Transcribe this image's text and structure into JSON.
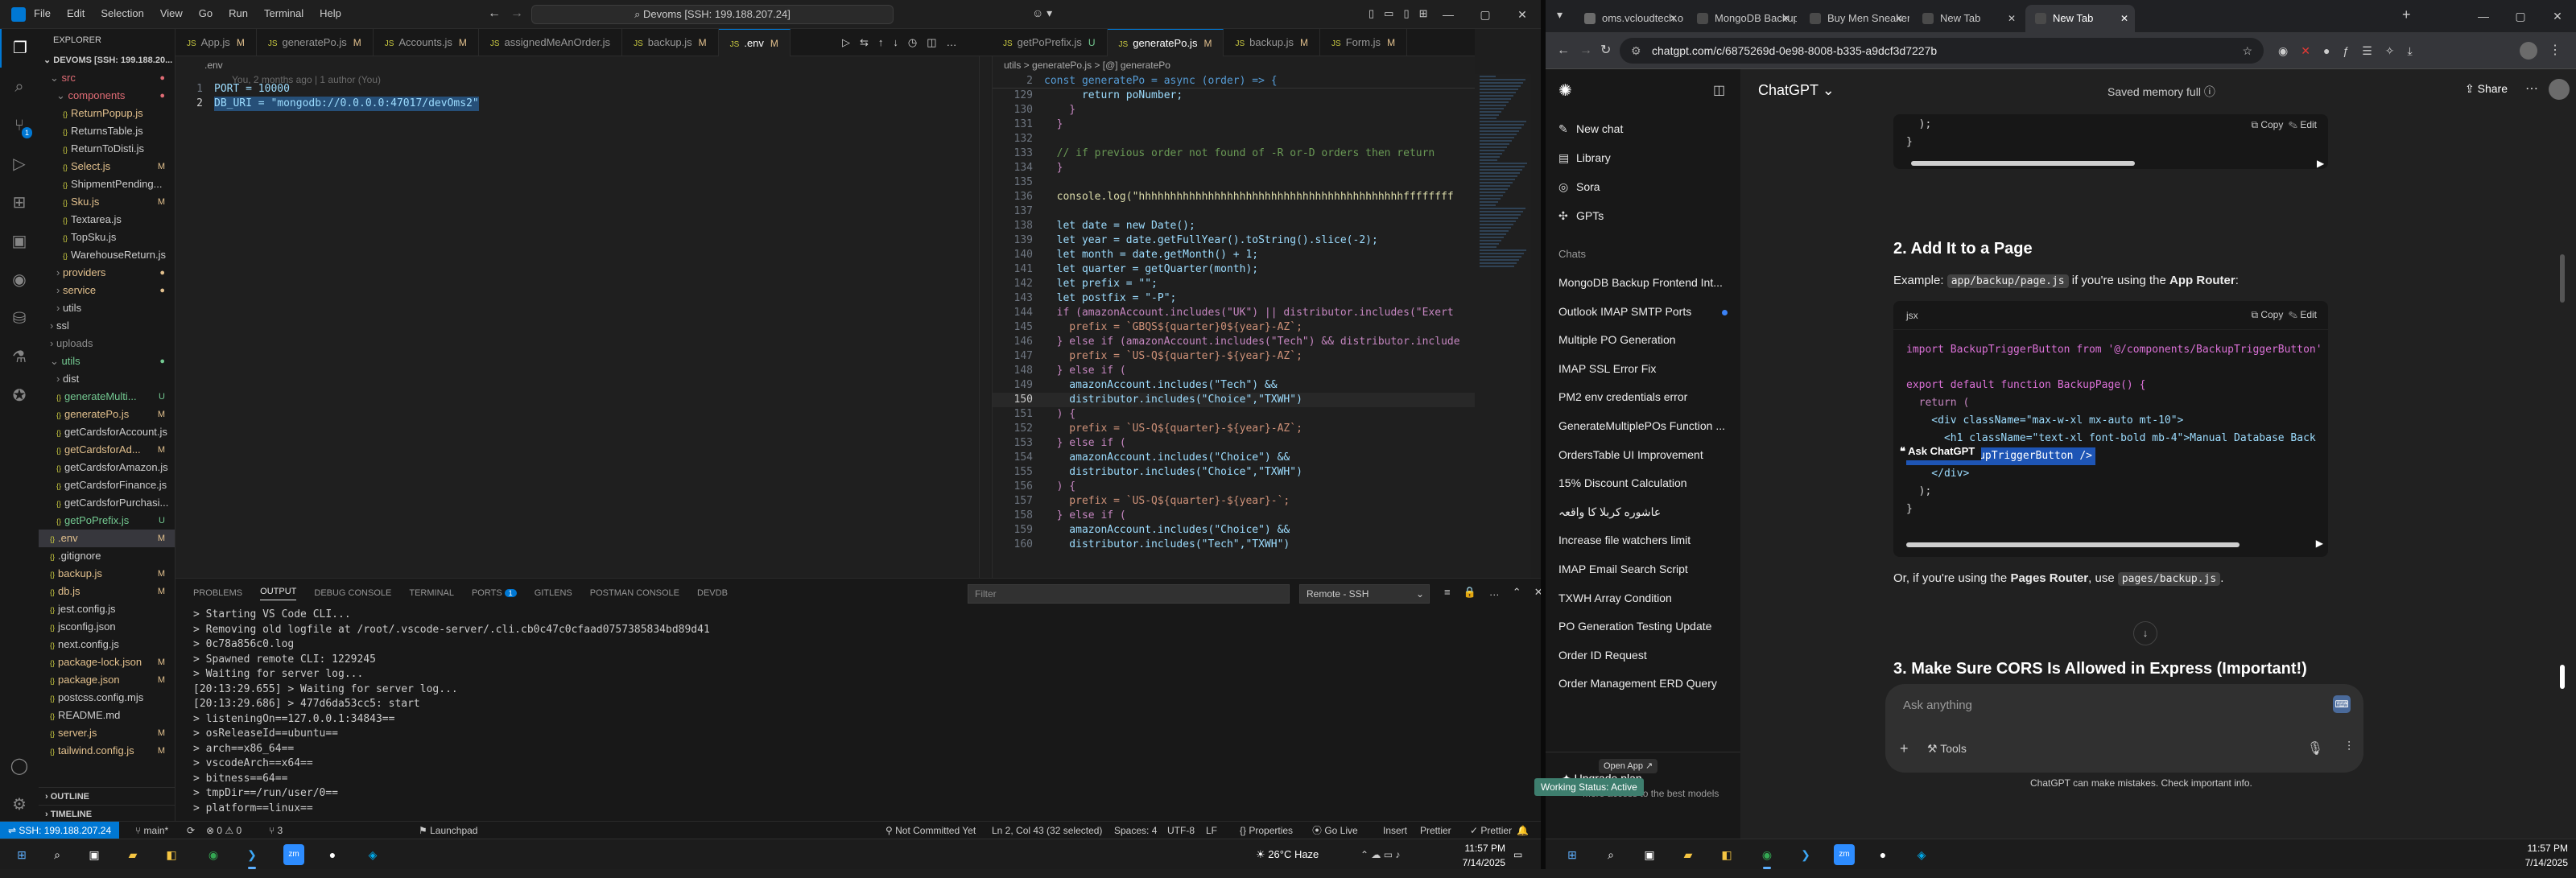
{
  "vscode": {
    "menu": [
      "File",
      "Edit",
      "Selection",
      "View",
      "Go",
      "Run",
      "Terminal",
      "Help"
    ],
    "search": "Devoms [SSH: 199.188.207.24]",
    "explorer_title": "EXPLORER",
    "root": "DEVOMS [SSH: 199.188.20...",
    "tree": [
      {
        "label": "src",
        "indent": 1,
        "type": "folder",
        "open": true,
        "color": "r",
        "status": "●"
      },
      {
        "label": "components",
        "indent": 2,
        "type": "folder",
        "open": true,
        "color": "r",
        "status": "●"
      },
      {
        "label": "ReturnPopup.js",
        "indent": 3,
        "type": "file",
        "color": "y",
        "status": ""
      },
      {
        "label": "ReturnsTable.js",
        "indent": 3,
        "type": "file",
        "color": "w",
        "status": ""
      },
      {
        "label": "ReturnToDisti.js",
        "indent": 3,
        "type": "file",
        "color": "w",
        "status": ""
      },
      {
        "label": "Select.js",
        "indent": 3,
        "type": "file",
        "color": "y",
        "status": "M"
      },
      {
        "label": "ShipmentPending...",
        "indent": 3,
        "type": "file",
        "color": "w",
        "status": ""
      },
      {
        "label": "Sku.js",
        "indent": 3,
        "type": "file",
        "color": "y",
        "status": "M"
      },
      {
        "label": "Textarea.js",
        "indent": 3,
        "type": "file",
        "color": "w",
        "status": ""
      },
      {
        "label": "TopSku.js",
        "indent": 3,
        "type": "file",
        "color": "w",
        "status": ""
      },
      {
        "label": "WarehouseReturn.js",
        "indent": 3,
        "type": "file",
        "color": "w",
        "status": ""
      },
      {
        "label": "providers",
        "indent": 2,
        "type": "folder",
        "open": false,
        "color": "y",
        "status": "●"
      },
      {
        "label": "service",
        "indent": 2,
        "type": "folder",
        "open": false,
        "color": "y",
        "status": "●"
      },
      {
        "label": "utils",
        "indent": 2,
        "type": "folder",
        "open": false,
        "color": "w",
        "status": ""
      },
      {
        "label": "ssl",
        "indent": 1,
        "type": "folder",
        "open": false,
        "color": "w",
        "status": ""
      },
      {
        "label": "uploads",
        "indent": 1,
        "type": "folder",
        "open": false,
        "color": "d",
        "status": ""
      },
      {
        "label": "utils",
        "indent": 1,
        "type": "folder",
        "open": true,
        "color": "g",
        "status": "●"
      },
      {
        "label": "dist",
        "indent": 2,
        "type": "folder",
        "open": false,
        "color": "w",
        "status": ""
      },
      {
        "label": "generateMulti...",
        "indent": 2,
        "type": "file",
        "color": "g",
        "status": "U"
      },
      {
        "label": "generatePo.js",
        "indent": 2,
        "type": "file",
        "color": "y",
        "status": "M"
      },
      {
        "label": "getCardsforAccount.js",
        "indent": 2,
        "type": "file",
        "color": "w",
        "status": ""
      },
      {
        "label": "getCardsforAd...",
        "indent": 2,
        "type": "file",
        "color": "y",
        "status": "M"
      },
      {
        "label": "getCardsforAmazon.js",
        "indent": 2,
        "type": "file",
        "color": "w",
        "status": ""
      },
      {
        "label": "getCardsforFinance.js",
        "indent": 2,
        "type": "file",
        "color": "w",
        "status": ""
      },
      {
        "label": "getCardsforPurchasi...",
        "indent": 2,
        "type": "file",
        "color": "w",
        "status": ""
      },
      {
        "label": "getPoPrefix.js",
        "indent": 2,
        "type": "file",
        "color": "g",
        "status": "U"
      },
      {
        "label": ".env",
        "indent": 1,
        "type": "file",
        "color": "y",
        "status": "M",
        "selected": true
      },
      {
        "label": ".gitignore",
        "indent": 1,
        "type": "file",
        "color": "w",
        "status": ""
      },
      {
        "label": "backup.js",
        "indent": 1,
        "type": "file",
        "color": "y",
        "status": "M"
      },
      {
        "label": "db.js",
        "indent": 1,
        "type": "file",
        "color": "y",
        "status": "M"
      },
      {
        "label": "jest.config.js",
        "indent": 1,
        "type": "file",
        "color": "w",
        "status": ""
      },
      {
        "label": "jsconfig.json",
        "indent": 1,
        "type": "file",
        "color": "w",
        "status": ""
      },
      {
        "label": "next.config.js",
        "indent": 1,
        "type": "file",
        "color": "w",
        "status": ""
      },
      {
        "label": "package-lock.json",
        "indent": 1,
        "type": "file",
        "color": "y",
        "status": "M"
      },
      {
        "label": "package.json",
        "indent": 1,
        "type": "file",
        "color": "y",
        "status": "M"
      },
      {
        "label": "postcss.config.mjs",
        "indent": 1,
        "type": "file",
        "color": "w",
        "status": ""
      },
      {
        "label": "README.md",
        "indent": 1,
        "type": "file",
        "color": "w",
        "status": ""
      },
      {
        "label": "server.js",
        "indent": 1,
        "type": "file",
        "color": "y",
        "status": "M"
      },
      {
        "label": "tailwind.config.js",
        "indent": 1,
        "type": "file",
        "color": "y",
        "status": "M"
      }
    ],
    "outline": "OUTLINE",
    "timeline": "TIMELINE",
    "tabs": [
      {
        "label": "App.js",
        "status": "M",
        "active": false
      },
      {
        "label": "generatePo.js",
        "status": "M",
        "active": false
      },
      {
        "label": "Accounts.js",
        "status": "M",
        "active": false
      },
      {
        "label": "assignedMeAnOrder.js",
        "status": "",
        "active": false
      },
      {
        "label": "backup.js",
        "status": "M",
        "active": false
      },
      {
        "label": ".env",
        "status": "M",
        "active": true
      }
    ],
    "tabs2": [
      {
        "label": "getPoPrefix.js",
        "status": "U",
        "active": false
      },
      {
        "label": "generatePo.js",
        "status": "M",
        "active": true
      },
      {
        "label": "backup.js",
        "status": "M",
        "active": false
      },
      {
        "label": "Form.js",
        "status": "M",
        "active": false
      }
    ],
    "editor1": {
      "breadcrumb": ".env",
      "blame": "You, 2 months ago | 1 author (You)",
      "lines": [
        {
          "n": "1",
          "text": "PORT = 10000"
        },
        {
          "n": "2",
          "text": "DB_URI = \"mongodb://0.0.0.0:47017/devOms2\""
        }
      ]
    },
    "editor2": {
      "breadcrumb": "utils > generatePo.js > [@] generatePo",
      "sticky": "const generatePo = async (order) => {",
      "sticky_n": "2",
      "lines": [
        {
          "n": "129",
          "t": "      return poNumber;"
        },
        {
          "n": "130",
          "t": "    }"
        },
        {
          "n": "131",
          "t": "  }"
        },
        {
          "n": "132",
          "t": ""
        },
        {
          "n": "133",
          "t": "  // if previous order not found of -R or-D orders then return"
        },
        {
          "n": "134",
          "t": "  }"
        },
        {
          "n": "135",
          "t": ""
        },
        {
          "n": "136",
          "t": "  console.log(\"hhhhhhhhhhhhhhhhhhhhhhhhhhhhhhhhhhhhhhhhhhffffffff"
        },
        {
          "n": "137",
          "t": ""
        },
        {
          "n": "138",
          "t": "  let date = new Date();"
        },
        {
          "n": "139",
          "t": "  let year = date.getFullYear().toString().slice(-2);"
        },
        {
          "n": "140",
          "t": "  let month = date.getMonth() + 1;"
        },
        {
          "n": "141",
          "t": "  let quarter = getQuarter(month);"
        },
        {
          "n": "142",
          "t": "  let prefix = \"\";"
        },
        {
          "n": "143",
          "t": "  let postfix = \"-P\";"
        },
        {
          "n": "144",
          "t": "  if (amazonAccount.includes(\"UK\") || distributor.includes(\"Exert"
        },
        {
          "n": "145",
          "t": "    prefix = `GBQS${quarter}0${year}-AZ`;"
        },
        {
          "n": "146",
          "t": "  } else if (amazonAccount.includes(\"Tech\") && distributor.include"
        },
        {
          "n": "147",
          "t": "    prefix = `US-Q${quarter}-${year}-AZ`;"
        },
        {
          "n": "148",
          "t": "  } else if ("
        },
        {
          "n": "149",
          "t": "    amazonAccount.includes(\"Tech\") &&"
        },
        {
          "n": "150",
          "t": "    distributor.includes(\"Choice\",\"TXWH\")"
        },
        {
          "n": "151",
          "t": "  ) {"
        },
        {
          "n": "152",
          "t": "    prefix = `US-Q${quarter}-${year}-AZ`;"
        },
        {
          "n": "153",
          "t": "  } else if ("
        },
        {
          "n": "154",
          "t": "    amazonAccount.includes(\"Choice\") &&"
        },
        {
          "n": "155",
          "t": "    distributor.includes(\"Choice\",\"TXWH\")"
        },
        {
          "n": "156",
          "t": "  ) {"
        },
        {
          "n": "157",
          "t": "    prefix = `US-Q${quarter}-${year}-`;"
        },
        {
          "n": "158",
          "t": "  } else if ("
        },
        {
          "n": "159",
          "t": "    amazonAccount.includes(\"Choice\") &&"
        },
        {
          "n": "160",
          "t": "    distributor.includes(\"Tech\",\"TXWH\")"
        }
      ],
      "current_line": "150"
    },
    "panel": {
      "tabs": [
        {
          "label": "PROBLEMS",
          "badge": ""
        },
        {
          "label": "OUTPUT",
          "badge": "",
          "active": true
        },
        {
          "label": "DEBUG CONSOLE",
          "badge": ""
        },
        {
          "label": "TERMINAL",
          "badge": ""
        },
        {
          "label": "PORTS",
          "badge": "1"
        },
        {
          "label": "GITLENS",
          "badge": ""
        },
        {
          "label": "POSTMAN CONSOLE",
          "badge": ""
        },
        {
          "label": "DEVDB",
          "badge": ""
        }
      ],
      "filter_placeholder": "Filter",
      "remote_select": "Remote - SSH",
      "output": [
        "> Starting VS Code CLI...",
        "> Removing old logfile at /root/.vscode-server/.cli.cb0c47c0cfaad0757385834bd89d41",
        "> 0c78a856c0.log",
        "> Spawned remote CLI: 1229245",
        "> Waiting for server log...",
        "[20:13:29.655] > Waiting for server log...",
        "[20:13:29.686] > 477d6da53cc5: start",
        "> listeningOn==127.0.0.1:34843==",
        "> osReleaseId==ubuntu==",
        "> arch==x86_64==",
        "> vscodeArch==x64==",
        "> bitness==64==",
        "> tmpDir==/run/user/0==",
        "> platform==linux=="
      ]
    },
    "status": {
      "remote": "SSH: 199.188.207.24",
      "branch": "main*",
      "sync": "⟳",
      "errors": "⊗ 0 ⚠ 0",
      "ports": "⑂ 3",
      "launchpad": "Launchpad",
      "commit": "Not Committed Yet",
      "position": "Ln 2, Col 43 (32 selected)",
      "spaces": "Spaces: 4",
      "encoding": "UTF-8",
      "eol": "LF",
      "props": "{} Properties",
      "golive": "Go Live",
      "insert": "Insert",
      "prettier": "Prettier",
      "prettier2": "✓ Prettier"
    }
  },
  "taskbar_left": {
    "weather": "26°C  Haze",
    "time": "11:57 PM",
    "date": "7/14/2025"
  },
  "browser": {
    "tabs": [
      {
        "label": "oms.vcloudtech.org/das",
        "color": "#6b6b6b"
      },
      {
        "label": "MongoDB Backup Fronte",
        "color": "#4a4a4a"
      },
      {
        "label": "Buy Men Sneakers - Me",
        "color": "#4a4a4a"
      },
      {
        "label": "New Tab",
        "color": "#4a4a4a"
      },
      {
        "label": "New Tab",
        "color": "#4a4a4a",
        "active": true
      }
    ],
    "url": "chatgpt.com/c/6875269d-0e98-8008-b335-a9dcf3d7227b"
  },
  "chatgpt": {
    "title": "ChatGPT",
    "memory": "Saved memory full",
    "share": "Share",
    "nav": [
      {
        "icon": "✎",
        "label": "New chat"
      },
      {
        "icon": "▤",
        "label": "Library"
      },
      {
        "icon": "◎",
        "label": "Sora"
      },
      {
        "icon": "✣",
        "label": "GPTs"
      }
    ],
    "chats_label": "Chats",
    "chats": [
      "MongoDB Backup Frontend Int...",
      "Outlook IMAP SMTP Ports",
      "Multiple PO Generation",
      "IMAP SSL Error Fix",
      "PM2 env credentials error",
      "GenerateMultiplePOs Function ...",
      "OrdersTable UI Improvement",
      "15% Discount Calculation",
      "عاشوره کربلا کا واقعہ",
      "Increase file watchers limit",
      "IMAP Email Search Script",
      "TXWH Array Condition",
      "PO Generation Testing Update",
      "Order ID Request",
      "Order Management ERD Query"
    ],
    "upgrade": "Upgrade plan",
    "upgrade_sub": "More access to the best models",
    "open_app": "Open App ↗",
    "working": "Working Status: Active",
    "copy": "Copy",
    "edit": "Edit",
    "top_code": [
      "  );",
      "}"
    ],
    "h2_1": "2. Add It to a Page",
    "example_prefix": "Example: ",
    "example_code": "app/backup/page.js",
    "example_mid": " if you're using the ",
    "example_bold": "App Router",
    "example_end": ":",
    "lang": "jsx",
    "code": [
      "import BackupTriggerButton from '@/components/BackupTriggerButton'",
      "",
      "export default function BackupPage() {",
      "  return (",
      "    <div className=\"max-w-xl mx-auto mt-10\">",
      "      <h1 className=\"text-xl font-bold mb-4\">Manual Database Back",
      "      <BackupTriggerButton />",
      "    </div>",
      "  );",
      "}"
    ],
    "ask_tooltip": "Ask ChatGPT",
    "or_prefix": "Or, if you're using the ",
    "or_bold": "Pages Router",
    "or_mid": ", use ",
    "or_code": "pages/backup.js",
    "or_end": ".",
    "h2_2": "3. Make Sure CORS Is Allowed in Express (Important!)",
    "input_placeholder": "Ask anything",
    "tools": "Tools",
    "disclaimer": "ChatGPT can make mistakes. Check important info.",
    "time": "11:57 PM",
    "date": "7/14/2025"
  }
}
